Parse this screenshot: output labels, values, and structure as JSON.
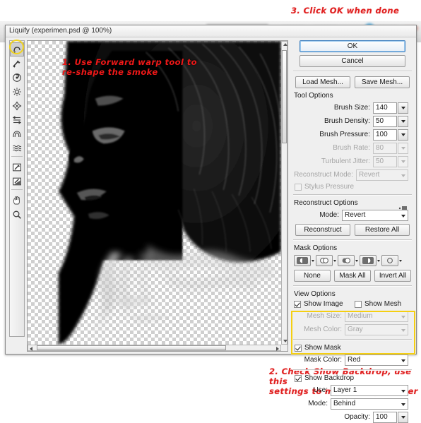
{
  "window": {
    "title": "Liquify (experimen.psd @ 100%)"
  },
  "annotations": [
    {
      "id": "top",
      "text": "3. Click OK when done"
    },
    {
      "id": "canvas",
      "text": "1. Use Forward warp tool to\nre-shape the smoke"
    },
    {
      "id": "bottom",
      "text": "2. Check Show Backdrop, use this\nsettings to made things easier"
    }
  ],
  "colors": {
    "annotation_red": "#e02020",
    "highlight_yellow": "#f5cf12",
    "dialog_bg": "#efefef",
    "primary_button_border": "#3d7fbf"
  },
  "toolbar": {
    "selected": "forward-warp-tool",
    "tools": [
      {
        "name": "forward-warp-tool",
        "label": "Forward Warp Tool"
      },
      {
        "name": "reconstruct-tool",
        "label": "Reconstruct Tool"
      },
      {
        "name": "twirl-clockwise-tool",
        "label": "Twirl Clockwise Tool"
      },
      {
        "name": "pucker-tool",
        "label": "Pucker Tool"
      },
      {
        "name": "bloat-tool",
        "label": "Bloat Tool"
      },
      {
        "name": "push-left-tool",
        "label": "Push Left Tool"
      },
      {
        "name": "mirror-tool",
        "label": "Mirror Tool"
      },
      {
        "name": "turbulence-tool",
        "label": "Turbulence Tool"
      },
      {
        "name": "freeze-mask-tool",
        "label": "Freeze Mask Tool"
      },
      {
        "name": "thaw-mask-tool",
        "label": "Thaw Mask Tool"
      },
      {
        "name": "hand-tool",
        "label": "Hand Tool"
      },
      {
        "name": "zoom-tool",
        "label": "Zoom Tool"
      }
    ]
  },
  "buttons": {
    "ok": "OK",
    "cancel": "Cancel",
    "load_mesh": "Load Mesh...",
    "save_mesh": "Save Mesh...",
    "reconstruct": "Reconstruct",
    "restore_all": "Restore All",
    "mask_none": "None",
    "mask_all": "Mask All",
    "mask_invert": "Invert All"
  },
  "tool_options": {
    "title": "Tool Options",
    "fields": [
      {
        "label": "Brush Size:",
        "value": "140",
        "disabled": false
      },
      {
        "label": "Brush Density:",
        "value": "50",
        "disabled": false
      },
      {
        "label": "Brush Pressure:",
        "value": "100",
        "disabled": false
      },
      {
        "label": "Brush Rate:",
        "value": "80",
        "disabled": true
      },
      {
        "label": "Turbulent Jitter:",
        "value": "50",
        "disabled": true
      }
    ],
    "reconstruct_mode": {
      "label": "Reconstruct Mode:",
      "value": "Revert",
      "disabled": true
    },
    "stylus_pressure": {
      "label": "Stylus Pressure",
      "checked": false,
      "disabled": true
    }
  },
  "reconstruct_options": {
    "title": "Reconstruct Options",
    "mode": {
      "label": "Mode:",
      "value": "Revert"
    }
  },
  "mask_options": {
    "title": "Mask Options",
    "modes": [
      {
        "name": "replace-selection-mask-icon"
      },
      {
        "name": "add-to-selection-mask-icon"
      },
      {
        "name": "subtract-from-selection-mask-icon"
      },
      {
        "name": "intersect-with-selection-mask-icon"
      },
      {
        "name": "invert-selection-mask-icon"
      }
    ]
  },
  "view_options": {
    "title": "View Options",
    "show_image": {
      "label": "Show Image",
      "checked": true
    },
    "show_mesh": {
      "label": "Show Mesh",
      "checked": false
    },
    "mesh_size": {
      "label": "Mesh Size:",
      "value": "Medium",
      "disabled": true
    },
    "mesh_color": {
      "label": "Mesh Color:",
      "value": "Gray",
      "disabled": true
    },
    "show_mask": {
      "label": "Show Mask",
      "checked": true
    },
    "mask_color": {
      "label": "Mask Color:",
      "value": "Red"
    },
    "show_backdrop": {
      "label": "Show Backdrop",
      "checked": true
    },
    "backdrop_use": {
      "label": "Use:",
      "value": "Layer 1"
    },
    "backdrop_mode": {
      "label": "Mode:",
      "value": "Behind"
    },
    "backdrop_opacity": {
      "label": "Opacity:",
      "value": "100"
    }
  }
}
